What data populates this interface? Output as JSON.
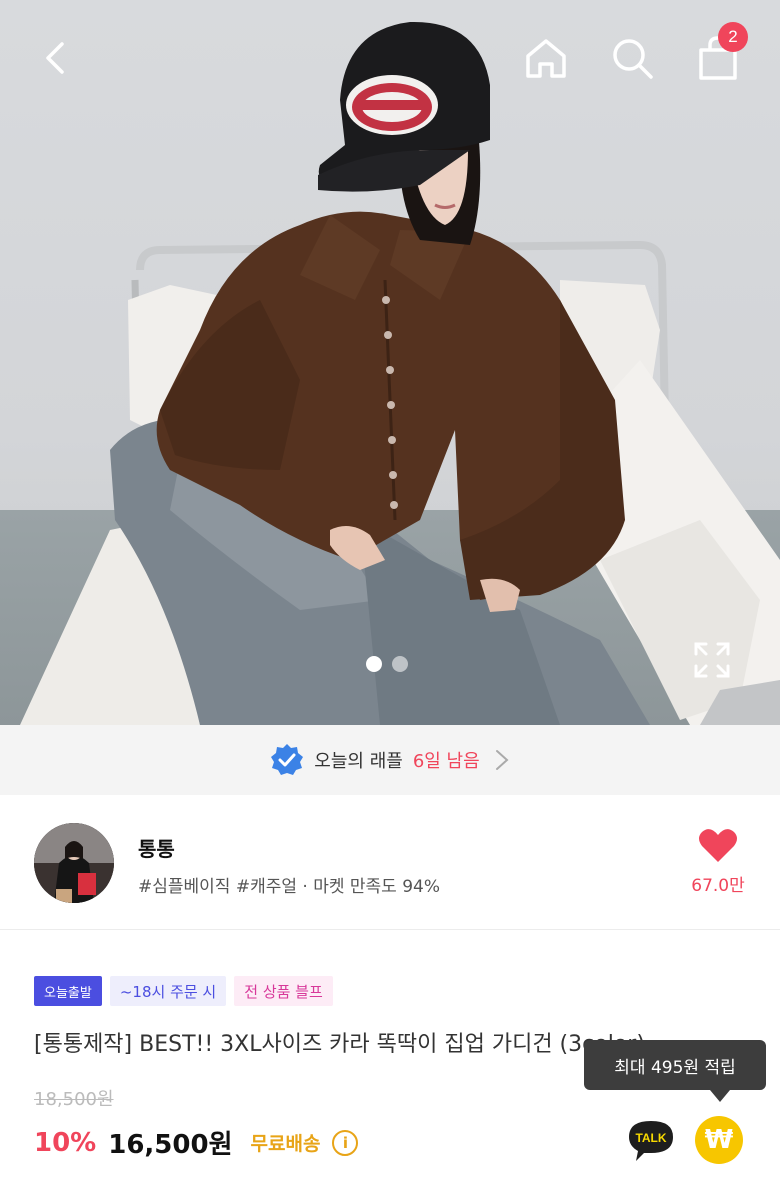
{
  "header": {
    "cart_count": "2"
  },
  "hero": {
    "photo_subject": "model in brown ribbed collar cardigan and grey jeans sitting on white chair",
    "carousel_total": 2,
    "carousel_index": 1
  },
  "raffle": {
    "label": "오늘의 래플",
    "remaining": "6일 남음"
  },
  "store": {
    "name": "통통",
    "tags": "#심플베이직 #캐주얼 · 마켓 만족도 94%",
    "likes": "67.0만"
  },
  "product": {
    "badges": [
      "오늘출발",
      "~18시 주문 시",
      "전 상품 블프"
    ],
    "title": "[통통제작] BEST!! 3XL사이즈 카라 똑딱이 집업 가디건 (3color)",
    "original_price": "18,500원",
    "discount": "10%",
    "price": "16,500원",
    "shipping": "무료배송",
    "info_glyph": "i",
    "reward_tooltip": "최대 495원 적립",
    "talk_label": "TALK",
    "coin_glyph": "₩"
  },
  "colors": {
    "accent_pink": "#f0455b",
    "verified_blue": "#3b82e6",
    "shipping_gold": "#e8a417",
    "coin_yellow": "#f7c600",
    "badge_purple": "#4b4ee0"
  }
}
